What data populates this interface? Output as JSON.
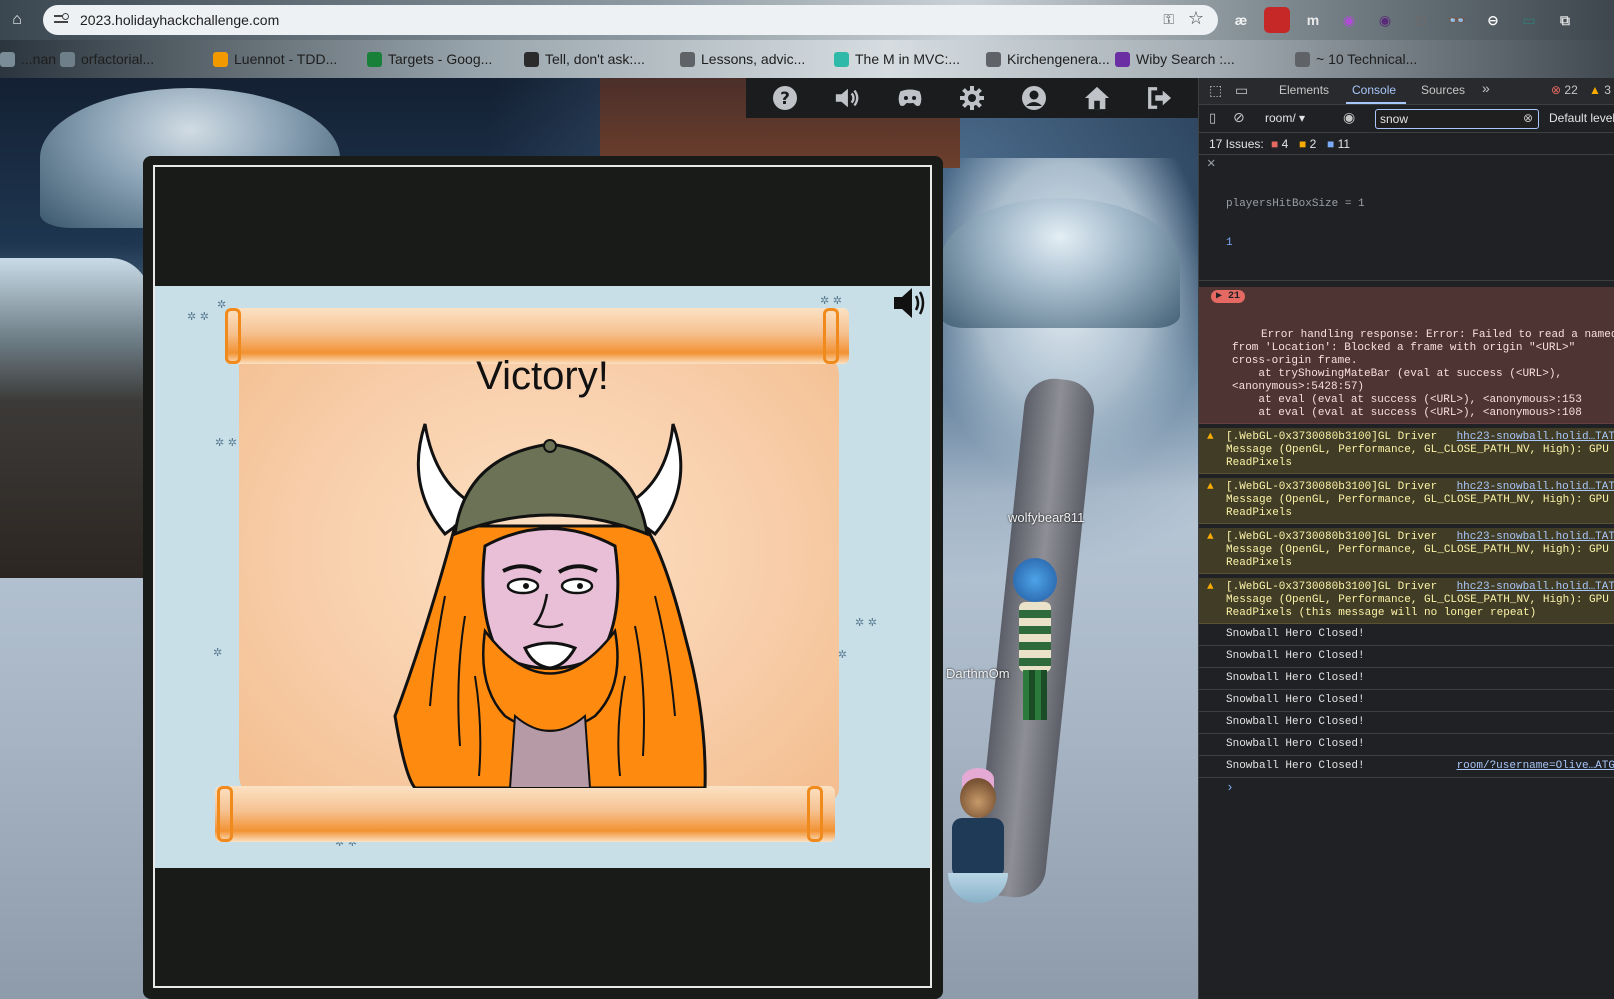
{
  "browser": {
    "url": "2023.holidayhackchallenge.com",
    "bookmarks": [
      {
        "label": "...nan",
        "color": "#7a8c98"
      },
      {
        "label": "orfactorial...",
        "color": "#6f7f89"
      },
      {
        "label": "Luennot - TDD...",
        "color": "#f29900"
      },
      {
        "label": "Targets - Goog...",
        "color": "#188038"
      },
      {
        "label": "Tell, don't ask:...",
        "color": "#2b2b2b"
      },
      {
        "label": "Lessons, advic...",
        "color": "#5f6368"
      },
      {
        "label": "The M in MVC:...",
        "color": "#2fb9a8"
      },
      {
        "label": "Kirchengenera...",
        "color": "#5f6368"
      },
      {
        "label": "Wiby Search :...",
        "color": "#6b2fa3"
      },
      {
        "label": "~ 10 Technical...",
        "color": "#5f6368"
      }
    ],
    "extensions": [
      "æ",
      "1",
      "m",
      "◉",
      "◉",
      "⊡",
      "👓",
      "⊖",
      "▭",
      "⧉"
    ]
  },
  "game": {
    "players": [
      "wolfybear811",
      "DarthmOm"
    ],
    "toolbar_icons": [
      "help-icon",
      "sound-icon",
      "discord-icon",
      "settings-icon",
      "profile-icon",
      "home-icon",
      "logout-icon"
    ]
  },
  "modal": {
    "title": "Victory!"
  },
  "devtools": {
    "tabs": [
      "Elements",
      "Console",
      "Sources"
    ],
    "active_tab": "Console",
    "error_count": "22",
    "warn_count": "3",
    "context": "room/",
    "filter_value": "snow",
    "default_levels": "Default levels",
    "issues": {
      "label": "17 Issues:",
      "errors": "4",
      "warnings": "2",
      "info": "11"
    },
    "expression": "playersHitBoxSize = 1",
    "expression_result": "1",
    "error_entry": {
      "count": "21",
      "lines": [
        "Error handling response: Error: Failed to read a named",
        "from 'Location': Blocked a frame with origin \"<URL>\"",
        "cross-origin frame.",
        "    at tryShowingMateBar (eval at success (<URL>),",
        "<anonymous>:5428:57)",
        "    at eval (eval at success (<URL>), <anonymous>:153",
        "    at eval (eval at success (<URL>), <anonymous>:108"
      ]
    },
    "warnings": [
      {
        "lines": [
          "[.WebGL-0x3730080b3100]GL Driver",
          "Message (OpenGL, Performance, GL_CLOSE_PATH_NV, High): GPU",
          "ReadPixels"
        ],
        "source": "hhc23-snowball.holid…TAT"
      },
      {
        "lines": [
          "[.WebGL-0x3730080b3100]GL Driver",
          "Message (OpenGL, Performance, GL_CLOSE_PATH_NV, High): GPU",
          "ReadPixels"
        ],
        "source": "hhc23-snowball.holid…TAT"
      },
      {
        "lines": [
          "[.WebGL-0x3730080b3100]GL Driver",
          "Message (OpenGL, Performance, GL_CLOSE_PATH_NV, High): GPU",
          "ReadPixels"
        ],
        "source": "hhc23-snowball.holid…TAT"
      },
      {
        "lines": [
          "[.WebGL-0x3730080b3100]GL Driver",
          "Message (OpenGL, Performance, GL_CLOSE_PATH_NV, High): GPU",
          "ReadPixels (this message will no longer repeat)"
        ],
        "source": "hhc23-snowball.holid…TAT"
      }
    ],
    "info_logs": [
      {
        "text": "Snowball Hero Closed!",
        "source": ""
      },
      {
        "text": "Snowball Hero Closed!",
        "source": ""
      },
      {
        "text": "Snowball Hero Closed!",
        "source": ""
      },
      {
        "text": "Snowball Hero Closed!",
        "source": ""
      },
      {
        "text": "Snowball Hero Closed!",
        "source": ""
      },
      {
        "text": "Snowball Hero Closed!",
        "source": ""
      },
      {
        "text": "Snowball Hero Closed!",
        "source": "room/?username=Olive…ATG"
      }
    ],
    "prompt": "›"
  }
}
